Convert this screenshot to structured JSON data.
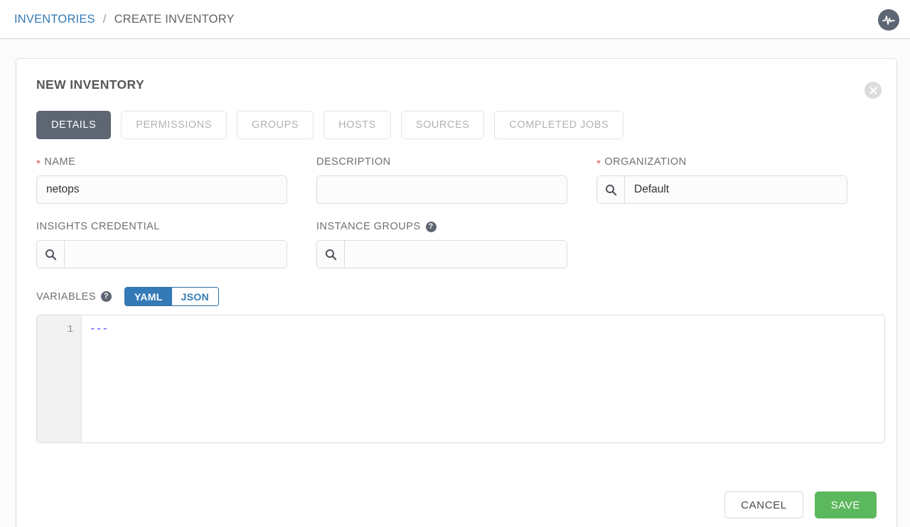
{
  "breadcrumb": {
    "root_label": "INVENTORIES",
    "separator": "/",
    "current_label": "CREATE INVENTORY"
  },
  "topbar": {
    "activity_icon": "activity-pulse-icon"
  },
  "card": {
    "title": "NEW INVENTORY",
    "close_icon": "close-icon",
    "close_glyph": "✕"
  },
  "tabs": [
    {
      "label": "DETAILS",
      "active": true,
      "name": "tab-details"
    },
    {
      "label": "PERMISSIONS",
      "active": false,
      "name": "tab-permissions"
    },
    {
      "label": "GROUPS",
      "active": false,
      "name": "tab-groups"
    },
    {
      "label": "HOSTS",
      "active": false,
      "name": "tab-hosts"
    },
    {
      "label": "SOURCES",
      "active": false,
      "name": "tab-sources"
    },
    {
      "label": "COMPLETED JOBS",
      "active": false,
      "name": "tab-completed-jobs"
    }
  ],
  "form": {
    "name": {
      "label": "NAME",
      "required": true,
      "required_marker": "*",
      "value": "netops",
      "placeholder": ""
    },
    "description": {
      "label": "DESCRIPTION",
      "required": false,
      "value": "",
      "placeholder": ""
    },
    "organization": {
      "label": "ORGANIZATION",
      "required": true,
      "required_marker": "*",
      "value": "Default",
      "placeholder": "",
      "search_icon": "search-icon"
    },
    "insights_credential": {
      "label": "INSIGHTS CREDENTIAL",
      "required": false,
      "value": "",
      "placeholder": "",
      "search_icon": "search-icon"
    },
    "instance_groups": {
      "label": "INSTANCE GROUPS",
      "required": false,
      "value": "",
      "placeholder": "",
      "help_icon": "help-circle-icon",
      "help_glyph": "?",
      "search_icon": "search-icon"
    }
  },
  "variables": {
    "label": "VARIABLES",
    "help_icon": "help-circle-icon",
    "help_glyph": "?",
    "format_options": [
      {
        "label": "YAML",
        "active": true
      },
      {
        "label": "JSON",
        "active": false
      }
    ],
    "yaml_label": "YAML",
    "json_label": "JSON",
    "line_numbers": "1",
    "content": "---"
  },
  "footer": {
    "cancel_label": "CANCEL",
    "save_label": "SAVE"
  },
  "colors": {
    "accent_blue": "#337ab7",
    "active_tab": "#5e6673",
    "save_green": "#5cb85c",
    "required_red": "#d9534f",
    "code_blue": "#2f33ff"
  }
}
